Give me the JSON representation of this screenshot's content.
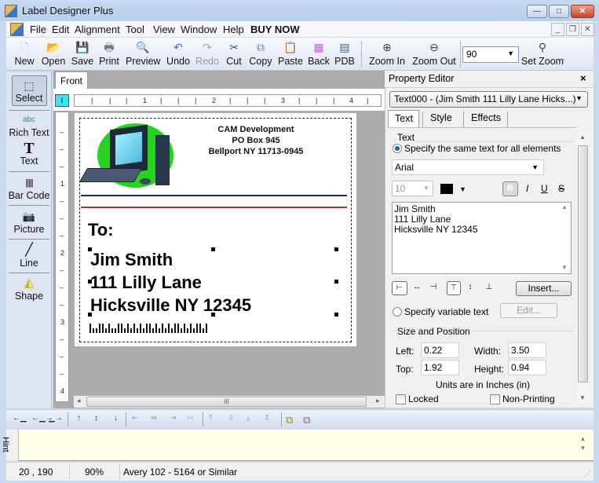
{
  "window": {
    "title": "Label Designer Plus",
    "controls": {
      "minimize": "—",
      "maximize": "□",
      "close": "✕"
    }
  },
  "menubar": {
    "items": [
      "File",
      "Edit",
      "Alignment",
      "Tool",
      "View",
      "Window",
      "Help"
    ],
    "buy_now": "BUY NOW",
    "mdi_controls": {
      "minimize": "_",
      "restore": "❐",
      "close": "✕"
    }
  },
  "toolbar": {
    "buttons": [
      {
        "label": "New",
        "icon": "new-document-icon",
        "glyph": "🗋"
      },
      {
        "label": "Open",
        "icon": "open-folder-icon",
        "glyph": "📂"
      },
      {
        "label": "Save",
        "icon": "save-disk-icon",
        "glyph": "💾"
      },
      {
        "label": "Print",
        "icon": "printer-icon",
        "glyph": "🖶"
      },
      {
        "label": "Preview",
        "icon": "preview-icon",
        "glyph": "🔍"
      },
      {
        "label": "Undo",
        "icon": "undo-icon",
        "glyph": "↶"
      },
      {
        "label": "Redo",
        "icon": "redo-icon",
        "glyph": "↷",
        "disabled": true
      },
      {
        "label": "Cut",
        "icon": "scissors-icon",
        "glyph": "✂"
      },
      {
        "label": "Copy",
        "icon": "copy-icon",
        "glyph": "⧉"
      },
      {
        "label": "Paste",
        "icon": "paste-icon",
        "glyph": "📋"
      },
      {
        "label": "Back",
        "icon": "background-icon",
        "glyph": "▦"
      },
      {
        "label": "PDB",
        "icon": "pdb-icon",
        "glyph": "▤"
      }
    ],
    "zoom_in": "Zoom In",
    "zoom_out": "Zoom Out",
    "zoom_value": "90",
    "set_zoom": "Set Zoom"
  },
  "tools": {
    "items": [
      {
        "label": "Select",
        "glyph": "⬚"
      },
      {
        "label": "Rich Text",
        "glyph": "abc"
      },
      {
        "label": "Text",
        "glyph": "T"
      },
      {
        "label": "Bar Code",
        "glyph": "|||||"
      },
      {
        "label": "Picture",
        "glyph": "📷"
      },
      {
        "label": "Line",
        "glyph": "╱"
      },
      {
        "label": "Shape",
        "glyph": "◭"
      }
    ]
  },
  "document": {
    "tab": "Front",
    "ruler_corner": "I",
    "h_ruler_numbers": [
      "1",
      "2",
      "3",
      "4"
    ],
    "v_ruler_numbers": [
      "1",
      "2",
      "3",
      "4"
    ],
    "sender": [
      "CAM Development",
      "PO Box 945",
      "Bellport NY 11713-0945"
    ],
    "to_label": "To:",
    "recipient": [
      "Jim Smith",
      "111 Lilly Lane",
      "Hicksville NY 12345"
    ],
    "line_colors": {
      "top": "#1c2a6b",
      "bottom": "#a83a2a"
    },
    "hscroll_grip": "III"
  },
  "property_editor": {
    "title": "Property Editor",
    "close": "×",
    "element": "Text000 - (Jim Smith 111 Lilly Lane Hicks...)",
    "tabs": [
      "Text",
      "Style",
      "Effects"
    ],
    "active_tab": "Text",
    "text_group": "Text",
    "same_text_option": "Specify the same text for all elements",
    "same_text_selected": true,
    "font": "Arial",
    "font_size": "10",
    "text_color": "#000000",
    "bold": "B",
    "italic": "I",
    "underline": "U",
    "strike": "S",
    "text_value": "Jim Smith\n111 Lilly Lane\nHicksville NY 12345",
    "insert_button": "Insert...",
    "variable_text_option": "Specify variable text",
    "variable_text_selected": false,
    "edit_button": "Edit...",
    "size_group": "Size and Position",
    "left_label": "Left:",
    "left_value": "0.22",
    "top_label": "Top:",
    "top_value": "1.92",
    "width_label": "Width:",
    "width_value": "3.50",
    "height_label": "Height:",
    "height_value": "0.94",
    "units_note": "Units are in Inches (in)",
    "locked_label": "Locked",
    "locked": false,
    "nonprinting_label": "Non-Printing",
    "nonprinting": false
  },
  "hint": {
    "label": "Hint",
    "text": ""
  },
  "status": {
    "coords": "20 , 190",
    "zoom": "90%",
    "label_type": "Avery 102 - 5164 or Similar"
  }
}
